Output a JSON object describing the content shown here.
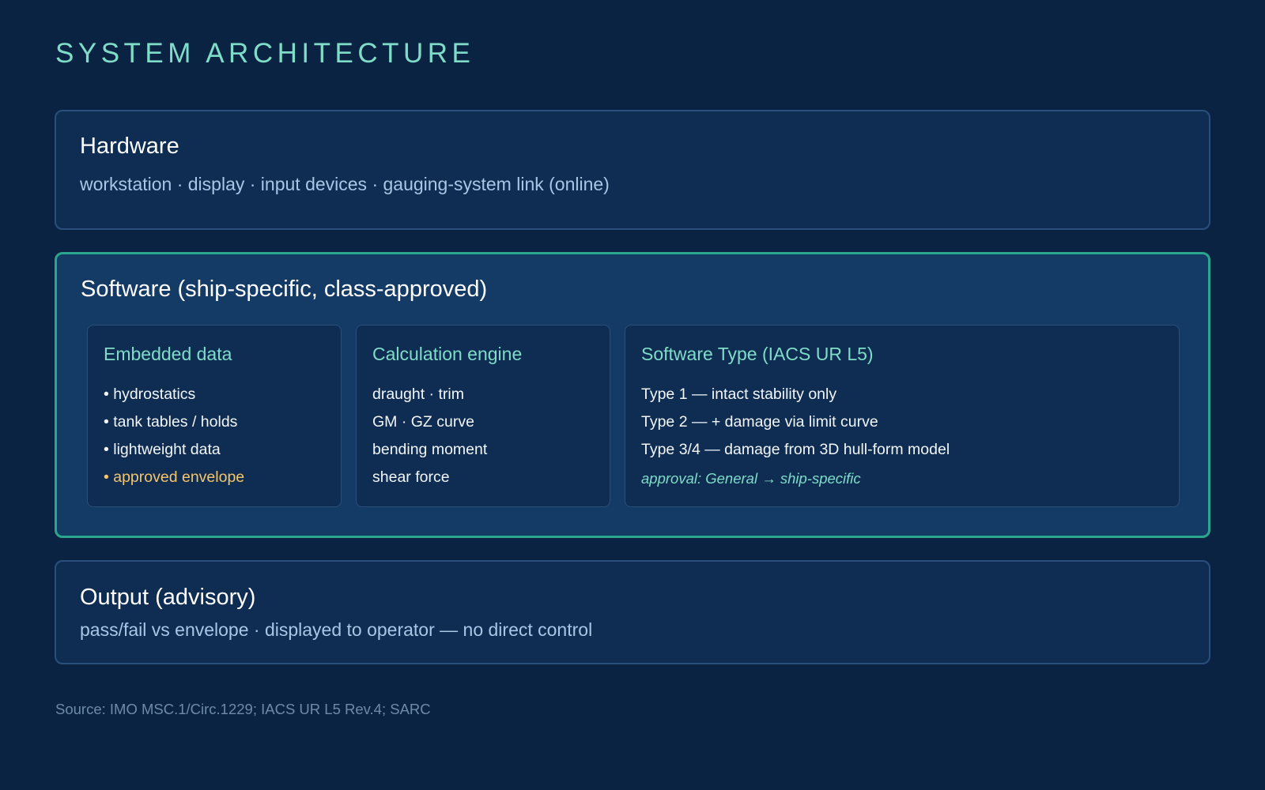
{
  "title": "SYSTEM ARCHITECTURE",
  "hardware": {
    "title": "Hardware",
    "description": "workstation · display · input devices · gauging-system link (online)"
  },
  "software": {
    "title": "Software (ship-specific, class-approved)",
    "embedded_data": {
      "title": "Embedded data",
      "items": [
        "• hydrostatics",
        "• tank tables / holds",
        "• lightweight data",
        "• approved envelope"
      ]
    },
    "calculation_engine": {
      "title": "Calculation engine",
      "items": [
        "draught · trim",
        "GM · GZ curve",
        "bending moment",
        "shear force"
      ]
    },
    "software_type": {
      "title": "Software Type (IACS UR L5)",
      "items": [
        "Type 1 — intact stability only",
        "Type 2 — + damage via limit curve",
        "Type 3/4 — damage from 3D hull-form model"
      ],
      "note": "approval: General → ship-specific"
    }
  },
  "output": {
    "title": "Output (advisory)",
    "description": "pass/fail vs envelope · displayed to operator — no direct control"
  },
  "source": "Source: IMO MSC.1/Circ.1229; IACS UR L5 Rev.4; SARC",
  "colors": {
    "background": "#0b2342",
    "panel": "#0f2d52",
    "software_panel": "#143a66",
    "accent_teal": "#7fdcc8",
    "software_border": "#2aa68e",
    "highlight_amber": "#f4c56b",
    "muted_text": "#a7c7e6"
  }
}
